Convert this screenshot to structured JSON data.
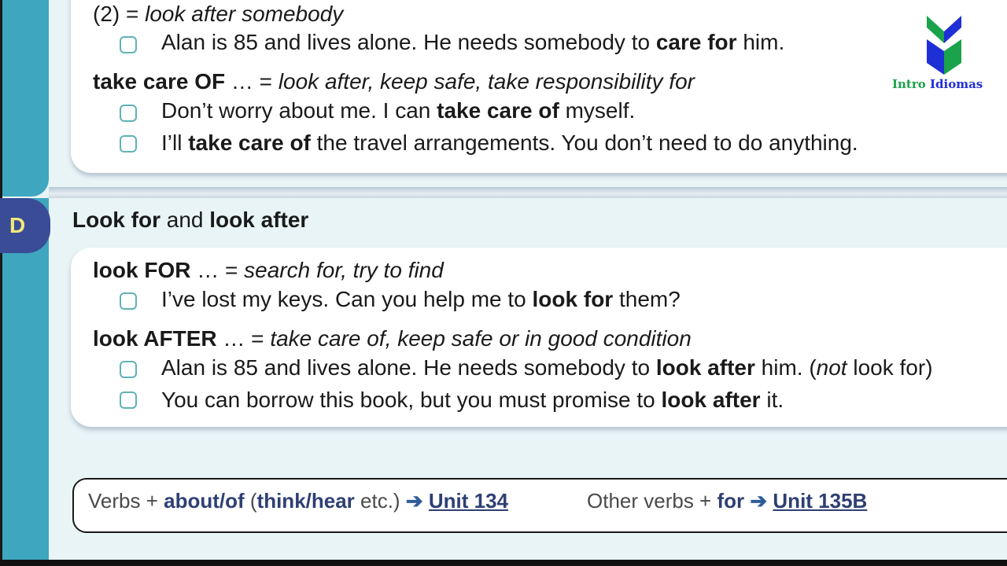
{
  "logo": {
    "word1": "Intro",
    "word2": "Idiomas",
    "color1": "#1aa34a",
    "color2": "#1f2fd6"
  },
  "top_section": {
    "sense2": {
      "num": "(2) = ",
      "meaning": "look after somebody"
    },
    "ex1": {
      "pre": "Alan is 85 and lives alone.  He needs somebody to ",
      "bold": "care for",
      "post": " him."
    },
    "take_care_of": {
      "head": "take care OF",
      "dots": " …  = ",
      "meaning": "look after, keep safe, take responsibility for"
    },
    "ex2": {
      "pre": "Don’t worry about me.  I can ",
      "bold": "take care of",
      "post": " myself."
    },
    "ex3": {
      "pre": "I’ll ",
      "bold": "take care of",
      "post": " the travel arrangements.  You don’t need to do anything."
    }
  },
  "section_d": {
    "badge": "D",
    "title": {
      "b1": "Look for",
      "mid": " and ",
      "b2": "look after"
    },
    "look_for": {
      "head": "look FOR",
      "dots": " …  = ",
      "meaning": "search for, try to find"
    },
    "ex1": {
      "pre": "I’ve lost my keys.  Can you help me to ",
      "bold": "look for",
      "post": " them?"
    },
    "look_after": {
      "head": "look AFTER",
      "dots": " …  = ",
      "meaning": "take care of, keep safe or in good condition"
    },
    "ex2": {
      "pre": "Alan is 85 and lives alone.  He needs somebody to ",
      "bold": "look after",
      "post": " him.   (",
      "it": "not",
      "post2": " look for)"
    },
    "ex3": {
      "pre": "You can borrow this book, but you must promise to ",
      "bold": "look after",
      "post": " it."
    }
  },
  "xref": {
    "left": {
      "t1": "Verbs + ",
      "b1": "about/of",
      "t2": " (",
      "b2": "think/hear",
      "t3": " etc.) ",
      "arrow": "➔",
      "link": "Unit 134"
    },
    "right": {
      "t1": "Other verbs + ",
      "b1": "for",
      "arrow": "➔",
      "link": "Unit 135B"
    }
  }
}
